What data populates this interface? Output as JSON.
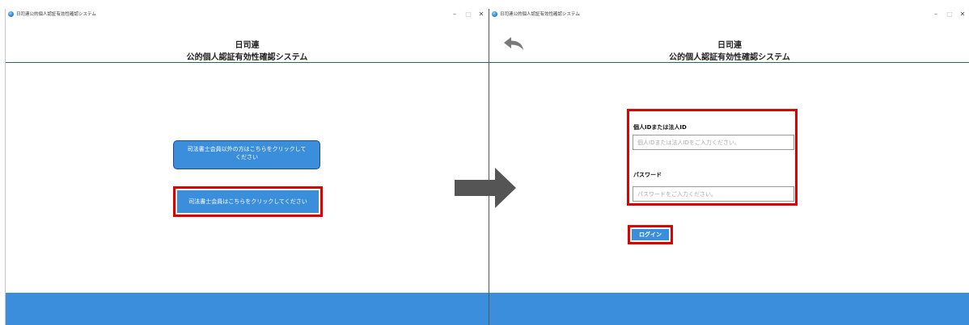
{
  "window_title": "日司連公的個人認証有効性確認システム",
  "header": {
    "line1": "日司連",
    "line2": "公的個人認証有効性確認システム"
  },
  "window_controls": {
    "minimize": "–",
    "maximize": "□",
    "close": "✕"
  },
  "left_screen": {
    "nonmember_button": "司法書士会員以外の方はこちらをクリックしてください",
    "member_button": "司法書士会員はこちらをクリックしてください"
  },
  "right_screen": {
    "id_label": "個人IDまたは法人ID",
    "id_placeholder": "個人IDまたは法人IDをご入力ください。",
    "password_label": "パスワード",
    "password_placeholder": "パスワードをご入力ください。",
    "login_button": "ログイン"
  },
  "colors": {
    "accent": "#3a8edb",
    "highlight": "#e10000",
    "transition_arrow": "#555555"
  },
  "icons": {
    "back": "back-arrow-icon",
    "app": "app-icon",
    "transition": "right-arrow-icon"
  }
}
